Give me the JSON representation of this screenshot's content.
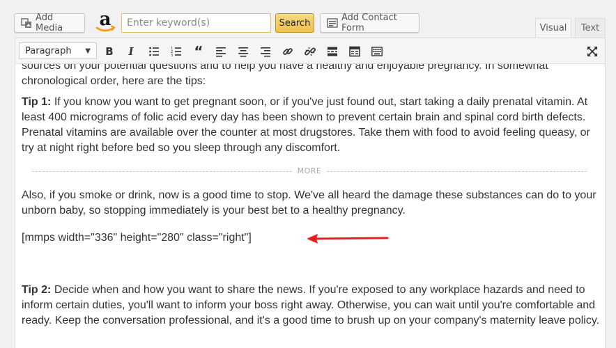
{
  "media_bar": {
    "add_media_label": "Add Media",
    "keyword_placeholder": "Enter keyword(s)",
    "search_label": "Search",
    "contact_form_label": "Add Contact Form"
  },
  "tabs": {
    "visual": "Visual",
    "text": "Text"
  },
  "toolbar": {
    "format_value": "Paragraph",
    "icons": [
      "bold-icon",
      "italic-icon",
      "bullet-list-icon",
      "numbered-list-icon",
      "blockquote-icon",
      "align-left-icon",
      "align-center-icon",
      "align-right-icon",
      "link-icon",
      "unlink-icon",
      "read-more-icon",
      "toolbar-toggle-icon",
      "keyboard-icon",
      "fullscreen-icon"
    ]
  },
  "content": {
    "p0": {
      "line1": "sources on your potential questions and to help you have a healthy and enjoyable pregnancy. In somewhat",
      "line2": "chronological order, here are the tips:"
    },
    "p1": {
      "label": "Tip 1:",
      "text": " If you know you want to get pregnant soon, or if you've just found out, start taking a daily prenatal vitamin. At least 400 micrograms of folic acid every day has been shown to prevent certain brain and spinal cord birth defects. Prenatal vitamins are available over the counter at most drugstores. Take them with food to avoid feeling queasy, or try at night right before bed so you sleep through any discomfort."
    },
    "more_label": "MORE",
    "p3": "Also, if you smoke or drink, now is a good time to stop. We've all heard the damage these substances can do to your unborn baby, so stopping immediately is your best bet to a healthy pregnancy.",
    "shortcode": "[mmps width=\"336\" height=\"280\" class=\"right\"]",
    "p5": {
      "label": "Tip 2:",
      "text": " Decide when and how you want to share the news. If you're exposed to any workplace hazards and need to inform certain duties, you'll want to inform your boss right away. Otherwise, you can wait until you're comfortable and ready. Keep the conversation professional, and it's a good time to brush up on your company's maternity leave policy."
    }
  },
  "colors": {
    "arrow": "#e8201c",
    "search_button": "#f0c14b",
    "keyword_border": "#e0c65e"
  }
}
